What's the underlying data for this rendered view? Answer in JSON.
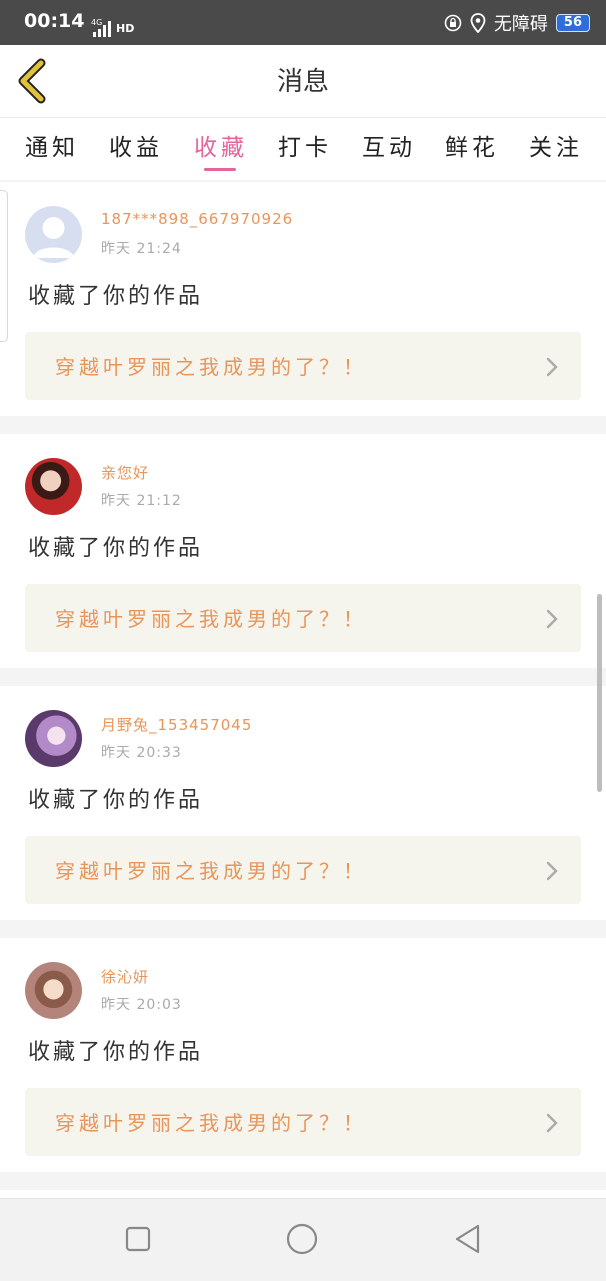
{
  "status_bar": {
    "time": "00:14",
    "network": "4G",
    "hd": "HD",
    "accessibility": "无障碍",
    "battery": "56"
  },
  "header": {
    "title": "消息"
  },
  "tabs": [
    {
      "label": "通知",
      "active": false
    },
    {
      "label": "收益",
      "active": false
    },
    {
      "label": "收藏",
      "active": true
    },
    {
      "label": "打卡",
      "active": false
    },
    {
      "label": "互动",
      "active": false
    },
    {
      "label": "鲜花",
      "active": false
    },
    {
      "label": "关注",
      "active": false
    }
  ],
  "messages": [
    {
      "username": "187***898_667970926",
      "time": "昨天 21:24",
      "action": "收藏了你的作品",
      "work_title": "穿越叶罗丽之我成男的了？！",
      "avatar": "default-avatar"
    },
    {
      "username": "亲您好",
      "time": "昨天 21:12",
      "action": "收藏了你的作品",
      "work_title": "穿越叶罗丽之我成男的了？！",
      "avatar": "user-avatar"
    },
    {
      "username": "月野兔_153457045",
      "time": "昨天 20:33",
      "action": "收藏了你的作品",
      "work_title": "穿越叶罗丽之我成男的了？！",
      "avatar": "user-avatar"
    },
    {
      "username": "徐沁妍",
      "time": "昨天 20:03",
      "action": "收藏了你的作品",
      "work_title": "穿越叶罗丽之我成男的了？！",
      "avatar": "user-avatar"
    }
  ],
  "colors": {
    "accent_pink": "#e5649a",
    "accent_orange": "#e8955a",
    "back_yellow": "#e2c23a"
  }
}
